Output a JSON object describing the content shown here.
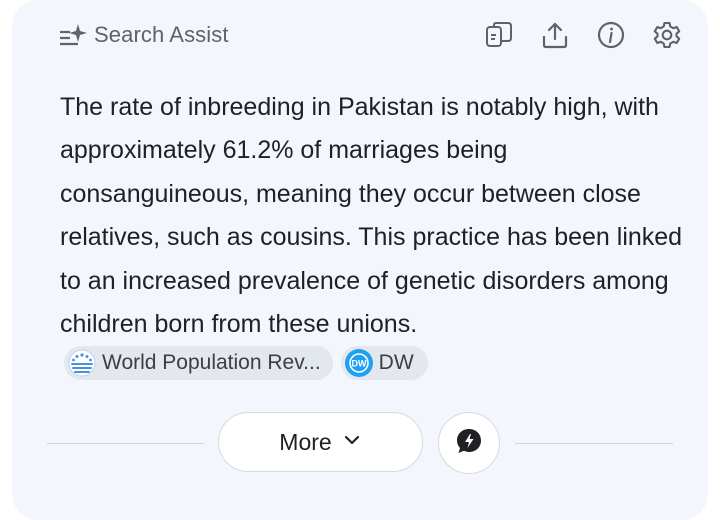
{
  "header": {
    "title": "Search Assist",
    "icons": [
      "sparkle-list-icon",
      "copy-icon",
      "share-icon",
      "info-icon",
      "gear-icon"
    ]
  },
  "answer": {
    "text": "The rate of inbreeding in Pakistan is notably high, with approximately 61.2% of marriages being consanguineous, meaning they occur between close relatives, such as cousins. This practice has been linked to an increased prevalence of genetic disorders among children born from these unions.",
    "sources": [
      {
        "label": "World Population Rev...",
        "icon": "globe-people-icon",
        "color": "#4a90e2"
      },
      {
        "label": "DW",
        "icon": "dw-logo-icon",
        "color": "#1da1f2"
      }
    ]
  },
  "footer": {
    "more_label": "More",
    "chat_icon": "chat-bubble-icon"
  },
  "colors": {
    "card_bg": "#f3f6fc",
    "chip_bg": "#e3e7ee",
    "text": "#202124",
    "muted": "#5f6368"
  }
}
